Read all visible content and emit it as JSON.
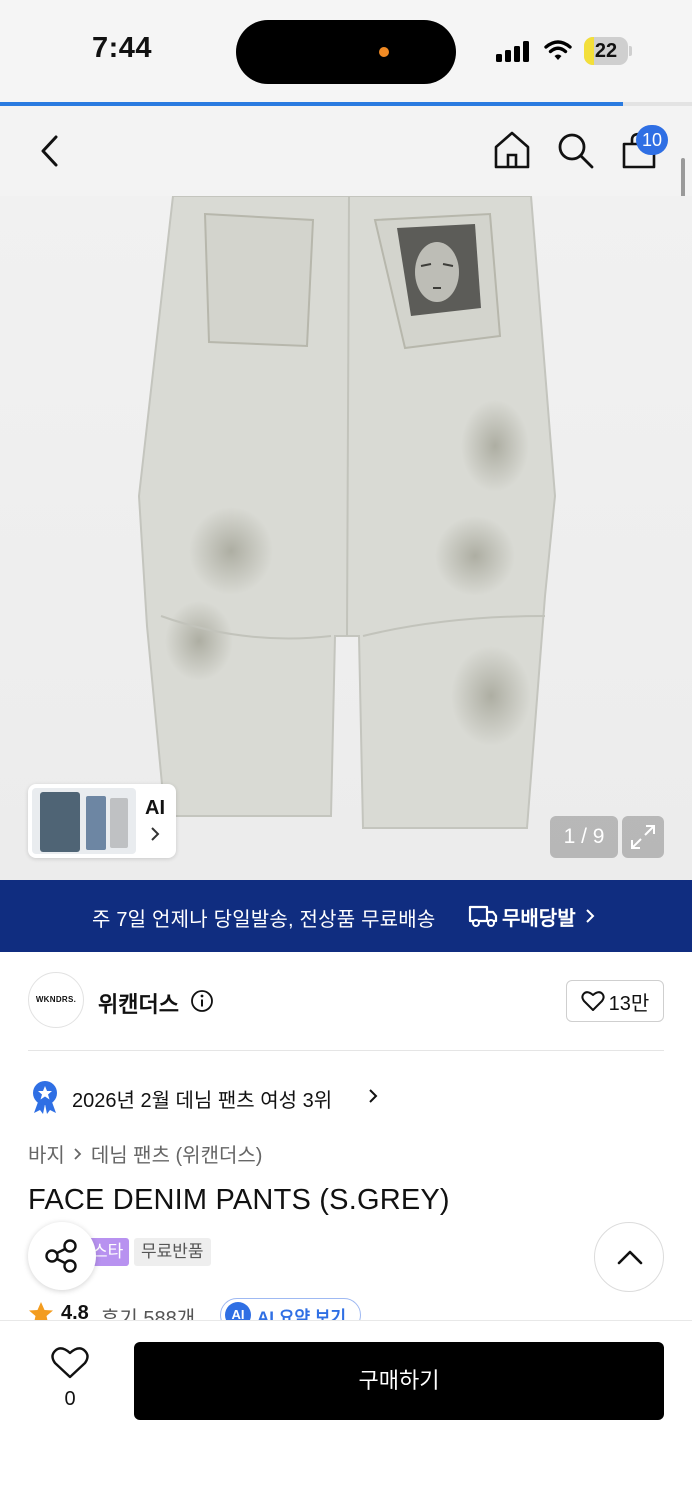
{
  "status_bar": {
    "time": "7:44",
    "battery": "22",
    "battery_level": 0.22
  },
  "page_load_progress": 0.9,
  "header": {
    "cart_count": "10"
  },
  "gallery": {
    "thumb_label": "AI",
    "counter": "1 / 9"
  },
  "promo": {
    "text": "주 7일 언제나 당일발송, 전상품 무료배송",
    "logo_text": "무배당발"
  },
  "brand": {
    "logo_text": "WKNDRS.",
    "name": "위캔더스",
    "likes": "13만"
  },
  "ranking": {
    "text": "2026년 2월 데님 팬츠 여성 3위"
  },
  "breadcrumb": {
    "category": "바지",
    "subcategory": "데님 팬츠 (위캔더스)"
  },
  "product": {
    "title": "FACE DENIM PANTS (S.GREY)",
    "tag_purple": "스타",
    "tag_grey": "무료반품",
    "rating": "4.8",
    "reviews": "후기 588개",
    "ai_badge": "AI",
    "ai_summary": "AI 요약 보기"
  },
  "bottom": {
    "wish_count": "0",
    "buy_label": "구매하기"
  },
  "colors": {
    "promo_bg": "#102d80",
    "accent_blue": "#2f6fe4",
    "buy_bg": "#000000"
  }
}
